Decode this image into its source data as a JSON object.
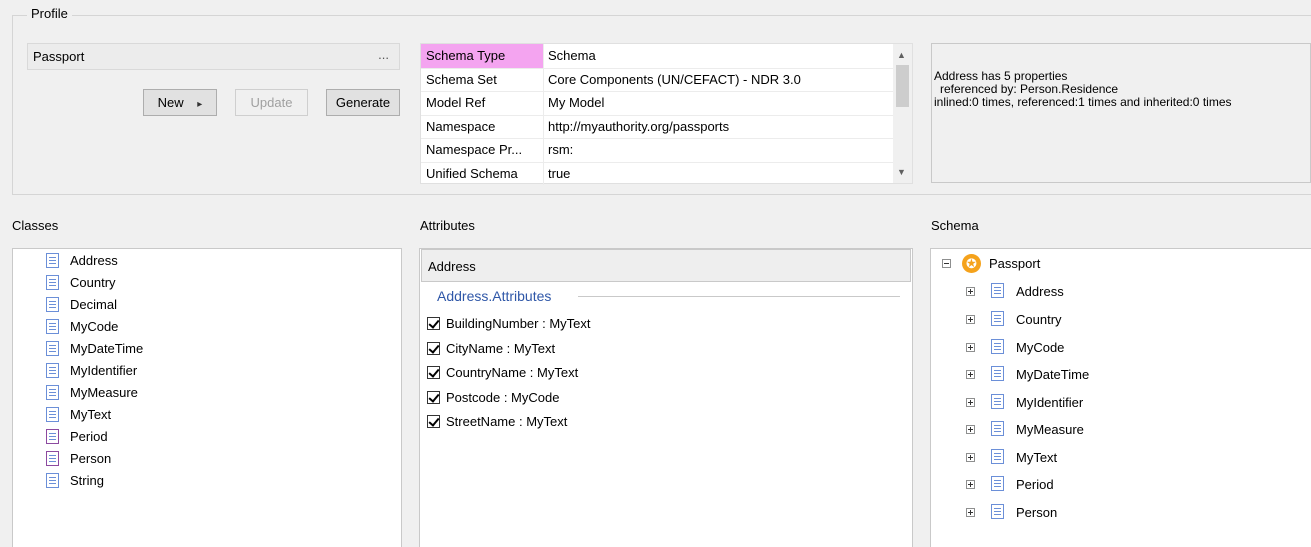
{
  "profile": {
    "legend": "Profile",
    "combo_value": "Passport",
    "combo_dots": "...",
    "new_label": "New",
    "new_arrow": "▸",
    "update_label": "Update",
    "generate_label": "Generate"
  },
  "properties": [
    {
      "key": "Schema Type",
      "value": "Schema",
      "selected": true
    },
    {
      "key": "Schema Set",
      "value": "Core Components (UN/CEFACT) - NDR 3.0"
    },
    {
      "key": "Model Ref",
      "value": "My Model"
    },
    {
      "key": "Namespace",
      "value": "http://myauthority.org/passports"
    },
    {
      "key": "Namespace Pr...",
      "value": "rsm:"
    },
    {
      "key": "Unified Schema",
      "value": "true"
    }
  ],
  "info": {
    "line1": "Address has 5 properties",
    "line2": "referenced by: Person.Residence",
    "line3": "inlined:0 times, referenced:1 times and inherited:0 times"
  },
  "classes": {
    "label": "Classes",
    "items": [
      {
        "name": "Address",
        "icon": "document-icon"
      },
      {
        "name": "Country",
        "icon": "document-icon"
      },
      {
        "name": "Decimal",
        "icon": "document-icon"
      },
      {
        "name": "MyCode",
        "icon": "document-icon"
      },
      {
        "name": "MyDateTime",
        "icon": "document-icon"
      },
      {
        "name": "MyIdentifier",
        "icon": "document-icon"
      },
      {
        "name": "MyMeasure",
        "icon": "document-icon"
      },
      {
        "name": "MyText",
        "icon": "document-icon"
      },
      {
        "name": "Period",
        "icon": "class-document-icon"
      },
      {
        "name": "Person",
        "icon": "class-document-icon"
      },
      {
        "name": "String",
        "icon": "document-icon"
      }
    ]
  },
  "attributes": {
    "label": "Attributes",
    "header": "Address",
    "group": "Address.Attributes",
    "items": [
      {
        "name": "BuildingNumber : MyText",
        "checked": true
      },
      {
        "name": "CityName : MyText",
        "checked": true
      },
      {
        "name": "CountryName : MyText",
        "checked": true
      },
      {
        "name": "Postcode : MyCode",
        "checked": true
      },
      {
        "name": "StreetName : MyText",
        "checked": true
      }
    ]
  },
  "schema": {
    "label": "Schema",
    "root": "Passport",
    "children": [
      "Address",
      "Country",
      "MyCode",
      "MyDateTime",
      "MyIdentifier",
      "MyMeasure",
      "MyText",
      "Period",
      "Person"
    ]
  },
  "colors": {
    "selected_key_bg": "#f4a4f0",
    "group_title": "#2f57a8",
    "icon_blue": "#6b8fd8",
    "star": "#f5a21b"
  }
}
